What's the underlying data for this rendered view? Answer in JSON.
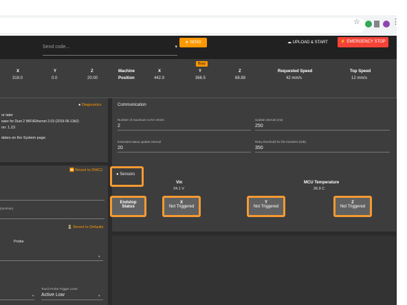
{
  "browser": {
    "star_icon": "star-icon",
    "menu_icon": "dots-menu-icon"
  },
  "toolbar": {
    "code_placeholder": "Send code...",
    "send_label": "SEND",
    "upload_label": "UPLOAD & START",
    "estop_label": "EMERGENCY STOP",
    "colors": {
      "send": "#ff9800",
      "estop": "#f44336"
    }
  },
  "status": {
    "badge": "Busy",
    "tool_axes": [
      {
        "axis": "X",
        "value": "319.0"
      },
      {
        "axis": "Y",
        "value": "0.0"
      },
      {
        "axis": "Z",
        "value": "20.00"
      }
    ],
    "machine_label": "Machine",
    "position_label": "Position",
    "machine_axes": [
      {
        "axis": "X",
        "value": "442.9"
      },
      {
        "axis": "Y",
        "value": "366.5"
      },
      {
        "axis": "Z",
        "value": "68.89"
      }
    ],
    "requested_speed_label": "Requested Speed",
    "requested_speed": "42 mm/s",
    "top_speed_label": "Top Speed",
    "top_speed": "12 mm/s"
  },
  "diagnostics": {
    "link": "Diagnostics",
    "lines": [
      "or later",
      "ware for Duet 2 WiFi/Ethernet 2.03 (2019-06-13b2)",
      "on: 1.23",
      "dates on the System page."
    ]
  },
  "communication": {
    "title": "Communication",
    "fields": [
      {
        "label": "Number of maximum AJAX retries",
        "value": "2"
      },
      {
        "label": "Update interval (ms)",
        "value": "250"
      },
      {
        "label": "Extended status update interval",
        "value": "20"
      },
      {
        "label": "Retry threshold for file transfers (KiB)",
        "value": "350"
      }
    ]
  },
  "dwc": {
    "revert_label": "Revert to DWC1",
    "unit_fragment": "(mm/min)"
  },
  "sensors": {
    "title": "Sensors",
    "vin_label": "Vin",
    "vin_value": "24.1 V",
    "mcu_label": "MCU Temperature",
    "mcu_value": "26.9 C",
    "endstop_label_1": "Endstop",
    "endstop_label_2": "Status",
    "endstops": [
      {
        "axis": "X",
        "state": "Not Triggered"
      },
      {
        "axis": "Y",
        "state": "Not Triggered"
      },
      {
        "axis": "Z",
        "state": "Not Triggered"
      }
    ]
  },
  "probe": {
    "revert_label": "Revert to Defaults",
    "probe_fragment": "Probe",
    "trigger_label": "Touch Probe Trigger Level",
    "trigger_value": "Active Low"
  }
}
